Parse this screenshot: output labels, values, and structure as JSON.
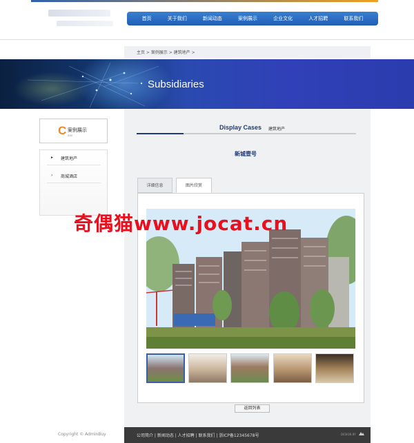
{
  "header": {
    "nav": [
      "首页",
      "关于我们",
      "新闻动态",
      "案例展示",
      "企业文化",
      "人才招聘",
      "联系我们"
    ]
  },
  "breadcrumb": "主页 > 案例展示 > 建筑地产 >",
  "banner": {
    "title": "Subsidiaries"
  },
  "sidebar": {
    "title": "案例展示",
    "title_initial": "C",
    "title_sub": "ase",
    "items": [
      {
        "label": "建筑地产",
        "arrow": "▸"
      },
      {
        "label": "商城酒店",
        "arrow": "›"
      }
    ]
  },
  "main": {
    "section_title": "Display Cases",
    "section_sub": "建筑地产",
    "item_title": "新城壹号",
    "tabs": [
      {
        "label": "详细信息",
        "active": false
      },
      {
        "label": "图片欣赏",
        "active": true
      }
    ],
    "watermark": "奇偶猫www.jocat.cn",
    "thumbnails": [
      "building-photo",
      "showroom-photo",
      "tower-photo",
      "lobby-photo",
      "interior-photo"
    ],
    "back_button": "返回列表"
  },
  "footer": {
    "links": "公司简介 | 新闻动态 | 人才招聘 | 联系我们 | 浙ICP备12345678号",
    "copyright": "Copyright © AdminBuy",
    "design_by": "DESIGN BY"
  },
  "colors": {
    "nav": "#1f5eb5",
    "accent_dark_blue": "#1e3a7a",
    "brand_orange": "#f08a1e",
    "watermark_red": "#e8101e",
    "footer": "#3a3a3a"
  }
}
